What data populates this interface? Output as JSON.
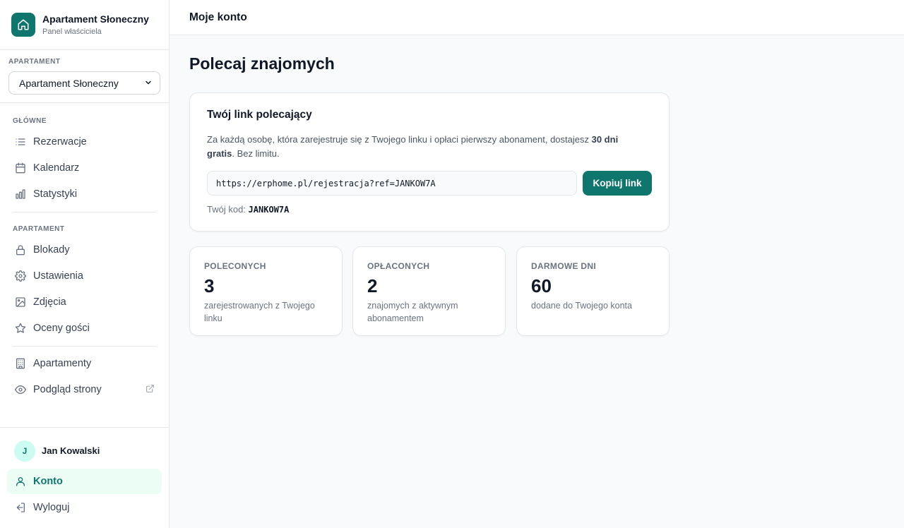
{
  "brand": {
    "title": "Apartament Słoneczny",
    "subtitle": "Panel właściciela"
  },
  "apartment_selector": {
    "label": "APARTAMENT",
    "selected": "Apartament Słoneczny"
  },
  "nav": {
    "group_main": "GŁÓWNE",
    "group_apartment": "APARTAMENT",
    "items": {
      "reservations": "Rezerwacje",
      "calendar": "Kalendarz",
      "stats": "Statystyki",
      "blocks": "Blokady",
      "settings": "Ustawienia",
      "photos": "Zdjęcia",
      "reviews": "Oceny gości",
      "apartments": "Apartamenty",
      "preview": "Podgląd strony"
    }
  },
  "user": {
    "initial": "J",
    "name": "Jan Kowalski",
    "account": "Konto",
    "logout": "Wyloguj"
  },
  "topbar": {
    "title": "Moje konto"
  },
  "page": {
    "title": "Polecaj znajomych"
  },
  "referral": {
    "title": "Twój link polecający",
    "desc_before": "Za każdą osobę, która zarejestruje się z Twojego linku i opłaci pierwszy abonament, dostajesz ",
    "desc_bold": "30 dni gratis",
    "desc_after": ". Bez limitu.",
    "link": "https://erphome.pl/rejestracja?ref=JANKOW7A",
    "copy_button": "Kopiuj link",
    "code_label": "Twój kod:",
    "code": "JANKOW7A"
  },
  "stats": [
    {
      "label": "POLECONYCH",
      "value": "3",
      "desc": "zarejestrowanych z Twojego linku"
    },
    {
      "label": "OPŁACONYCH",
      "value": "2",
      "desc": "znajomych z aktywnym abonamentem"
    },
    {
      "label": "DARMOWE DNI",
      "value": "60",
      "desc": "dodane do Twojego konta"
    }
  ],
  "colors": {
    "accent": "#0f766e",
    "accent_light": "#ecfdf5",
    "border": "#e5e7eb",
    "background": "#f9fafb"
  }
}
